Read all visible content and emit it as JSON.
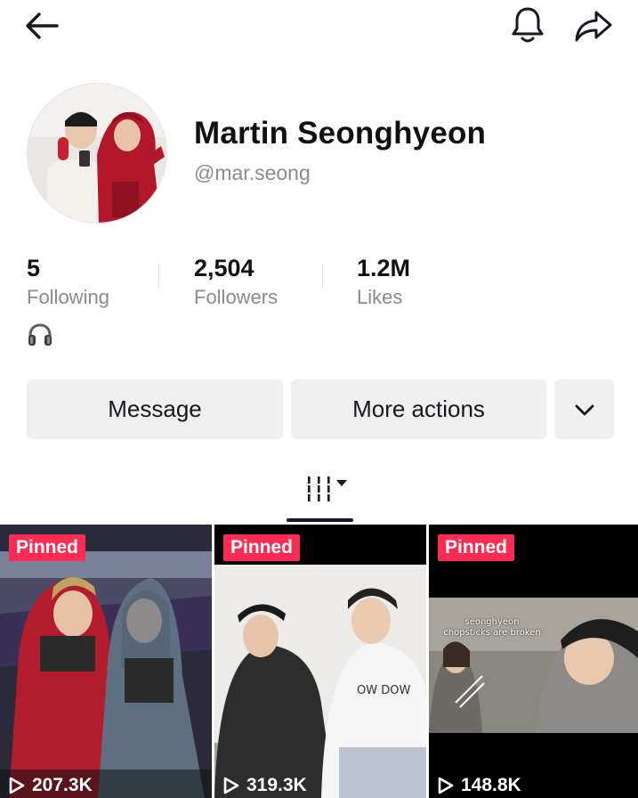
{
  "header": {
    "back_icon": "arrow-left-icon",
    "bell_icon": "bell-icon",
    "share_icon": "share-arrow-icon"
  },
  "profile": {
    "name": "Martin Seonghyeon",
    "handle": "@mar.seong",
    "bio_icon": "headphones-icon"
  },
  "stats": [
    {
      "value": "5",
      "label": "Following"
    },
    {
      "value": "2,504",
      "label": "Followers"
    },
    {
      "value": "1.2M",
      "label": "Likes"
    }
  ],
  "actions": {
    "message_label": "Message",
    "more_label": "More actions",
    "dropdown_icon": "chevron-down-icon"
  },
  "tabs": {
    "videos_icon": "grid-lines-icon",
    "sort_icon": "caret-down-icon"
  },
  "videos": [
    {
      "badge": "Pinned",
      "views": "207.3K",
      "play_icon": "play-outline-icon"
    },
    {
      "badge": "Pinned",
      "views": "319.3K",
      "play_icon": "play-outline-icon"
    },
    {
      "badge": "Pinned",
      "views": "148.8K",
      "play_icon": "play-outline-icon",
      "overlay_text": "seonghyeon chopsticks are broken"
    }
  ],
  "colors": {
    "pinned_badge": "#fe2c55",
    "button_bg": "#efefef",
    "secondary_text": "#8a8b91"
  }
}
